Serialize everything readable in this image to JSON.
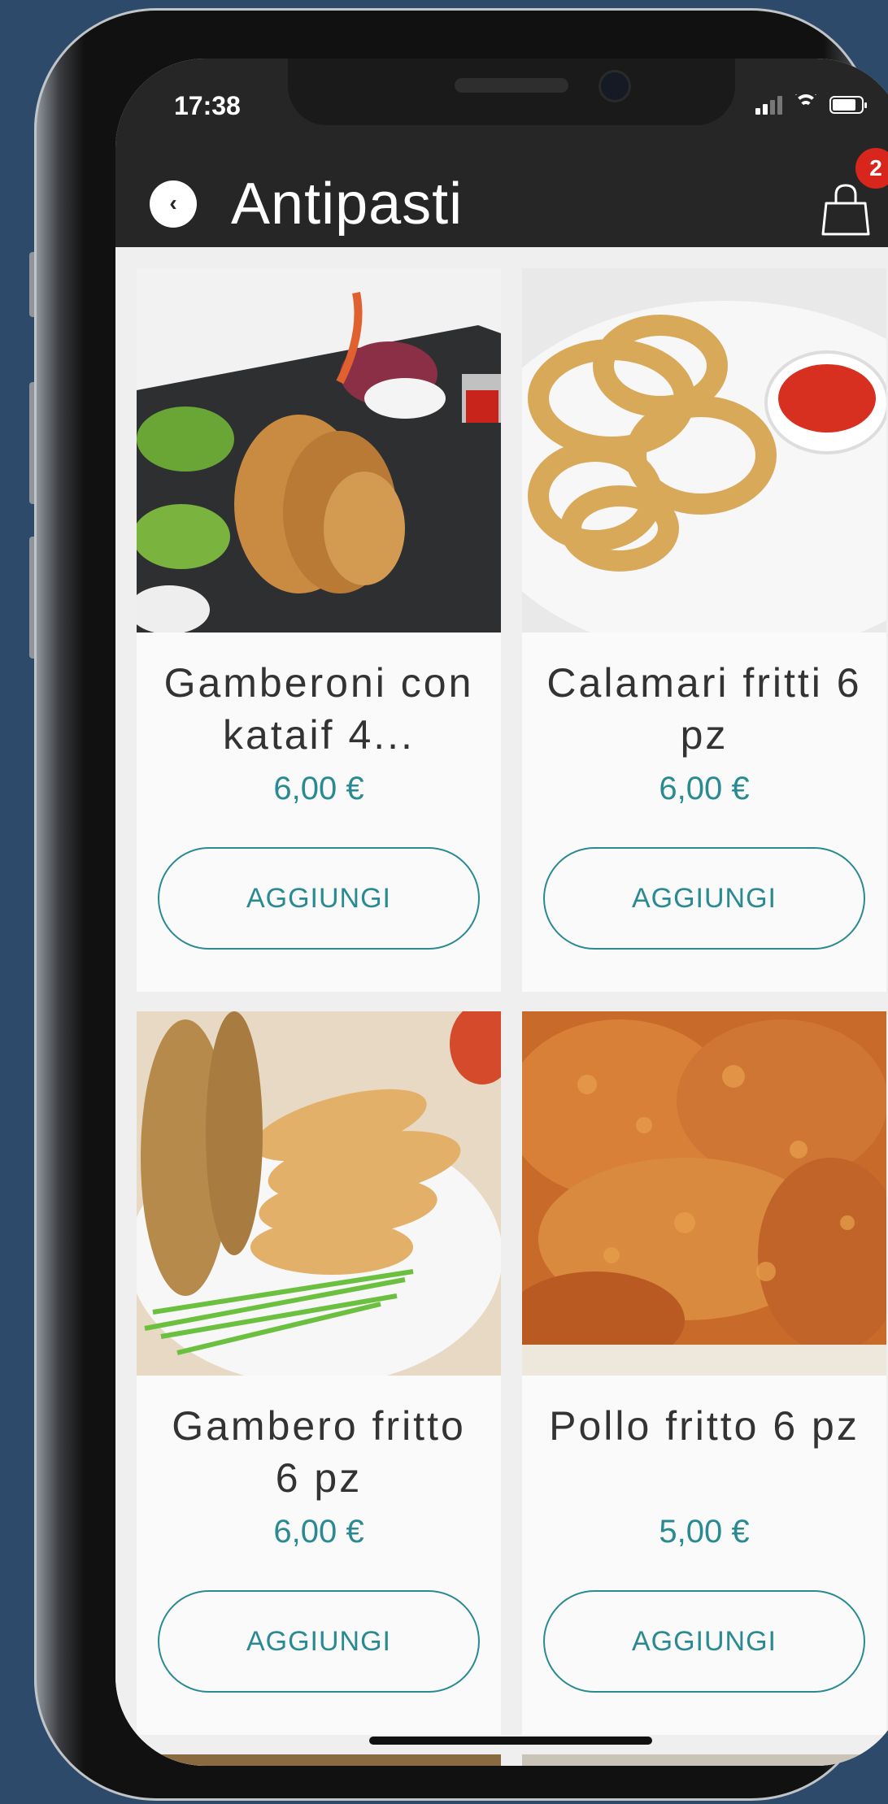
{
  "status_bar": {
    "time": "17:38"
  },
  "header": {
    "title": "Antipasti",
    "cart_count": "2"
  },
  "products": [
    {
      "name": "Gamberoni con kataif 4...",
      "price": "6,00 €",
      "button": "AGGIUNGI",
      "image": "fried-shrimp-kataif-photo"
    },
    {
      "name": "Calamari fritti 6 pz",
      "price": "6,00 €",
      "button": "AGGIUNGI",
      "image": "fried-calamari-rings-photo"
    },
    {
      "name": "Gambero fritto 6 pz",
      "price": "6,00 €",
      "button": "AGGIUNGI",
      "image": "fried-shrimp-bowl-photo"
    },
    {
      "name": "Pollo fritto 6 pz",
      "price": "5,00 €",
      "button": "AGGIUNGI",
      "image": "fried-chicken-photo"
    }
  ],
  "colors": {
    "accent": "#2a8a92",
    "header_bg": "#262626",
    "badge": "#d9261c",
    "background": "#2e4a6a"
  }
}
